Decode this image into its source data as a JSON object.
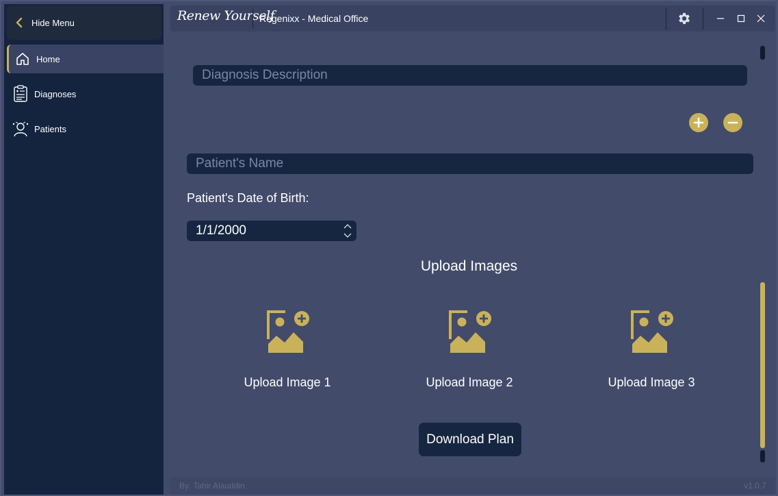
{
  "sidebar": {
    "hide_menu_label": "Hide Menu",
    "items": [
      {
        "label": "Home",
        "icon": "home-icon"
      },
      {
        "label": "Diagnoses",
        "icon": "clipboard-icon"
      },
      {
        "label": "Patients",
        "icon": "patient-icon"
      }
    ]
  },
  "titlebar": {
    "brand": "Renew Yourself",
    "title": "Regenixx - Medical Office"
  },
  "form": {
    "diagnosis_placeholder": "Diagnosis Description",
    "patient_name_placeholder": "Patient's Name",
    "dob_label": "Patient's Date of Birth:",
    "dob_value": "1/1/2000"
  },
  "uploads": {
    "heading": "Upload Images",
    "items": [
      {
        "label": "Upload Image 1"
      },
      {
        "label": "Upload Image 2"
      },
      {
        "label": "Upload Image 3"
      }
    ]
  },
  "download_label": "Download Plan",
  "footer": {
    "author": "By: Tahir Alauddin",
    "version": "v1.0.7"
  },
  "colors": {
    "accent": "#c9b25a",
    "sidebar_bg": "#14243f",
    "content_bg": "#434b6a",
    "field_bg": "#162640"
  }
}
